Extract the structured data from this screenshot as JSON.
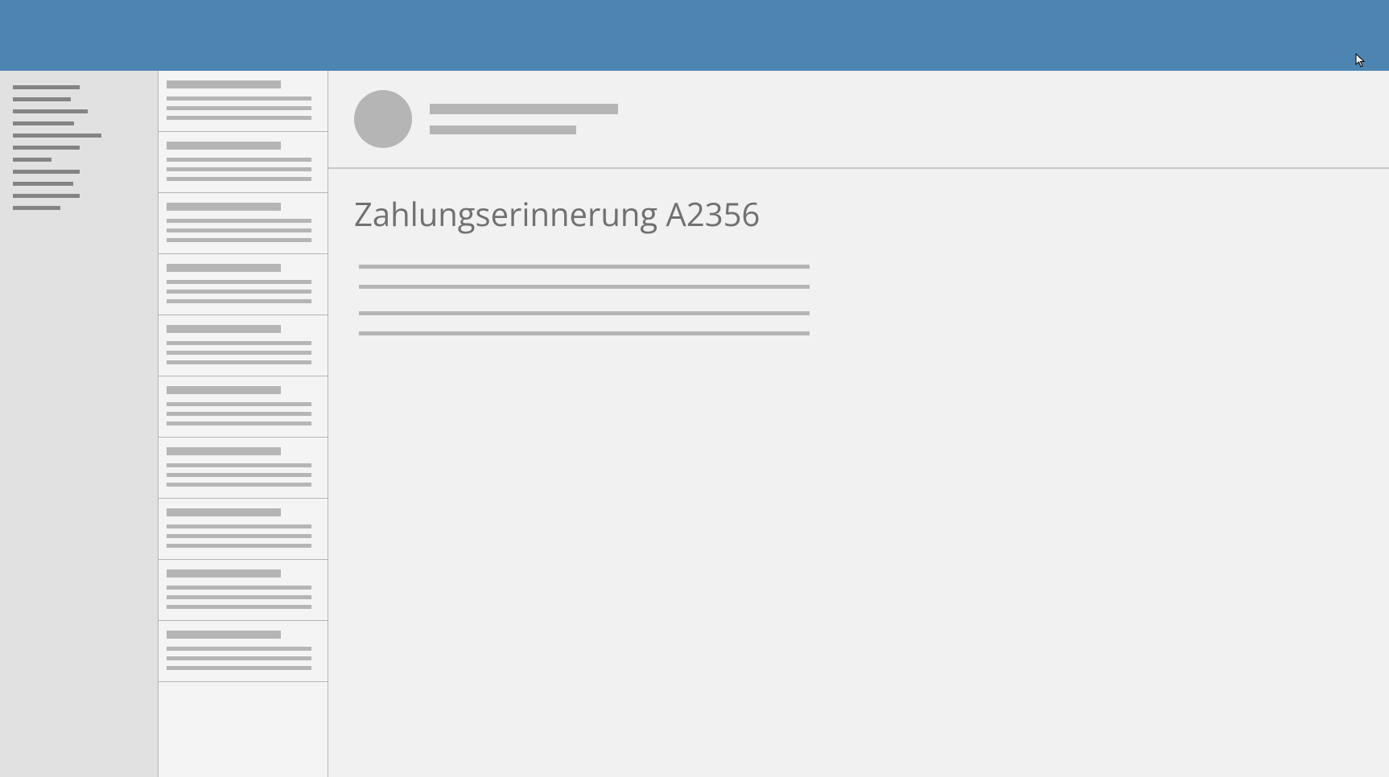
{
  "header": {
    "color": "#4d85b2"
  },
  "nav": {
    "line_widths": [
      83,
      72,
      93,
      76,
      110,
      83,
      48,
      83,
      75,
      83,
      59
    ]
  },
  "list": {
    "items": [
      {
        "title_width": 142,
        "lines": [
          180,
          180,
          180
        ]
      },
      {
        "title_width": 142,
        "lines": [
          180,
          180,
          180
        ]
      },
      {
        "title_width": 142,
        "lines": [
          180,
          180,
          180
        ]
      },
      {
        "title_width": 142,
        "lines": [
          180,
          180,
          180
        ]
      },
      {
        "title_width": 142,
        "lines": [
          180,
          180,
          180
        ]
      },
      {
        "title_width": 142,
        "lines": [
          180,
          180,
          180
        ]
      },
      {
        "title_width": 142,
        "lines": [
          180,
          180,
          180
        ]
      },
      {
        "title_width": 142,
        "lines": [
          180,
          180,
          180
        ]
      },
      {
        "title_width": 142,
        "lines": [
          180,
          180,
          180
        ]
      },
      {
        "title_width": 142,
        "lines": [
          180,
          180,
          180
        ]
      }
    ]
  },
  "message": {
    "sender_line1_width": 234,
    "sender_line2_width": 182,
    "subject": "Zahlungserinnerung A2356",
    "body_line_widths": [
      560,
      560,
      560,
      560
    ]
  }
}
